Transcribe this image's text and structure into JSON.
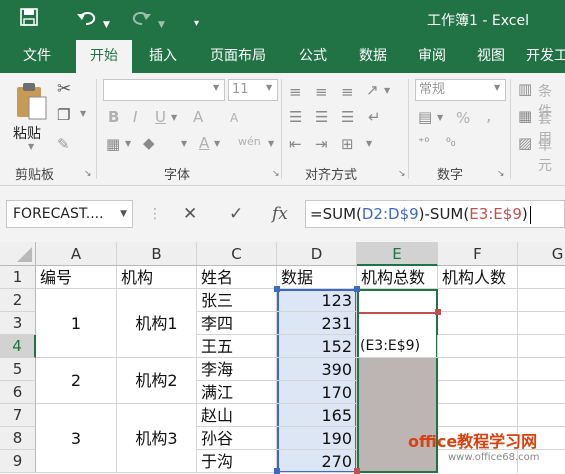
{
  "window": {
    "title": "工作簿1 - Excel",
    "quick_access": {
      "save_icon": "save-icon",
      "undo_icon": "undo-icon",
      "redo_icon": "redo-icon",
      "customize_icon": "customize-icon"
    }
  },
  "ribbon_tabs": [
    "文件",
    "开始",
    "插入",
    "页面布局",
    "公式",
    "数据",
    "审阅",
    "视图",
    "开发工"
  ],
  "active_tab": "开始",
  "ribbon": {
    "clipboard": {
      "paste_label": "粘贴",
      "group_label": "剪贴板"
    },
    "font": {
      "font_name": "",
      "font_size": "11",
      "bold": "B",
      "italic": "I",
      "underline": "U",
      "grow": "A",
      "shrink": "A",
      "font_color": "A",
      "wen": "wén",
      "group_label": "字体"
    },
    "alignment": {
      "group_label": "对齐方式"
    },
    "number": {
      "format": "常规",
      "percent": "%",
      "comma": ",",
      "group_label": "数字"
    },
    "styles": {
      "conditional": "条件",
      "table": "套用",
      "cell": "单元"
    }
  },
  "formula_bar": {
    "name_box": "FORECAST....",
    "cancel": "✕",
    "enter": "✓",
    "fx": "fx",
    "formula": {
      "prefix": "=SUM(",
      "ref1": "D2:D$9",
      "mid": ")-SUM(",
      "ref2": "E3:E$9",
      "suffix": ")"
    },
    "ref1_color": "#3d68c4",
    "ref2_color": "#c0504d"
  },
  "grid": {
    "columns": [
      "A",
      "B",
      "C",
      "D",
      "E",
      "F",
      "G"
    ],
    "selected_column": "E",
    "rows": [
      "1",
      "2",
      "3",
      "4",
      "5",
      "6",
      "7",
      "8",
      "9"
    ],
    "selected_row": "4",
    "headers": {
      "A1": "编号",
      "B1": "机构",
      "C1": "姓名",
      "D1": "数据",
      "E1": "机构总数",
      "F1": "机构人数"
    },
    "merged": [
      {
        "id": "A2",
        "value": "1"
      },
      {
        "id": "B2",
        "value": "机构1"
      },
      {
        "id": "A5",
        "value": "2"
      },
      {
        "id": "B5",
        "value": "机构2"
      },
      {
        "id": "A7",
        "value": "3"
      },
      {
        "id": "B7",
        "value": "机构3"
      }
    ],
    "names": [
      "张三",
      "李四",
      "王五",
      "李海",
      "满江",
      "赵山",
      "孙谷",
      "于沟"
    ],
    "data": [
      123,
      231,
      152,
      390,
      170,
      165,
      190,
      270
    ],
    "editing_cell_text": "(E3:E$9)",
    "watermark": {
      "line1": "office教程学习网",
      "line2": "www.office68.com"
    }
  },
  "colors": {
    "excel_green": "#217346",
    "ref_blue_fill": "#dce6f4",
    "ref_red_fill": "#bdb5b3"
  }
}
